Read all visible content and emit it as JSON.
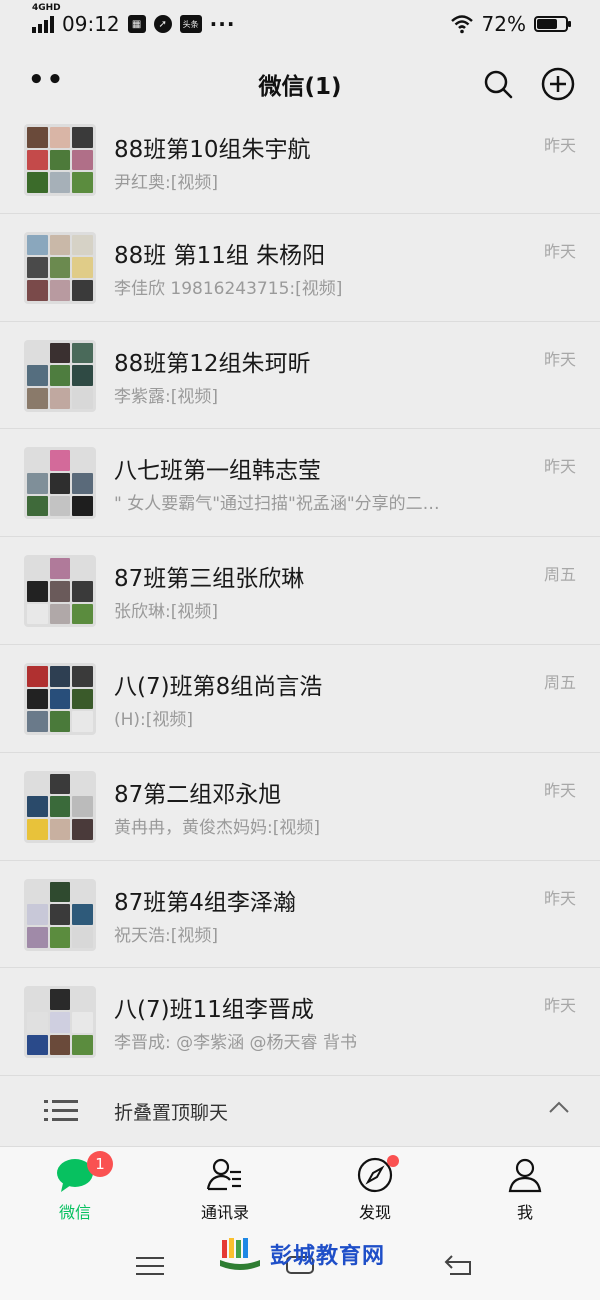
{
  "status_bar": {
    "network": "4GHD",
    "time": "09:12",
    "notif_badge": "头条",
    "more": "···",
    "battery": "72%",
    "battery_level": 0.72
  },
  "header": {
    "title": "微信(1)"
  },
  "chats": [
    {
      "name": "88班第10组朱宇航",
      "preview": "尹红奥:[视频]",
      "time": "昨天",
      "tiles": [
        "#6a4a3a",
        "#d9b5a6",
        "#3a3a3a",
        "#c44a4a",
        "#4d7a3a",
        "#b06f88",
        "#3b6b2a",
        "#a6b0b8",
        "#5b8c3e"
      ]
    },
    {
      "name": "88班  第11组  朱杨阳",
      "preview": "李佳欣 19816243715:[视频]",
      "time": "昨天",
      "tiles": [
        "#8aa7bd",
        "#c9b8a8",
        "#d6d2c6",
        "#4a4a4a",
        "#6b8a4f",
        "#e0cc88",
        "#7a4a4a",
        "#b89aa0",
        "#3a3a3a"
      ]
    },
    {
      "name": "88班第12组朱珂昕",
      "preview": "李紫露:[视频]",
      "time": "昨天",
      "tiles": [
        "#dddddd",
        "#3a3030",
        "#4a6a5a",
        "#556e7f",
        "#4e7d3f",
        "#2f4a44",
        "#8a7a6a",
        "#c0a8a0",
        "#d8d8d8"
      ]
    },
    {
      "name": "八七班第一组韩志莹",
      "preview": "\" 女人要霸气\"通过扫描\"祝孟涵\"分享的二…",
      "time": "昨天",
      "tiles": [
        "#dddddd",
        "#d36a9a",
        "#dddddd",
        "#7f8f99",
        "#2e2e2e",
        "#5a6a7a",
        "#3f6a3a",
        "#c3c3c3",
        "#1e1e1e"
      ]
    },
    {
      "name": "87班第三组张欣琳",
      "preview": "张欣琳:[视频]",
      "time": "周五",
      "tiles": [
        "#dddddd",
        "#b07a9a",
        "#dddddd",
        "#222222",
        "#6a5a5a",
        "#3a3a3a",
        "#e8e8e8",
        "#b0a8a8",
        "#5b8c3e"
      ]
    },
    {
      "name": "八(7)班第8组尚言浩",
      "preview": "(H):[视频]",
      "time": "周五",
      "tiles": [
        "#b03030",
        "#2e3f52",
        "#3a3a3a",
        "#222222",
        "#284e7a",
        "#3a5a2a",
        "#6a7a8a",
        "#4a7a3a",
        "#e8e8e8"
      ]
    },
    {
      "name": "87第二组邓永旭",
      "preview": "黄冉冉，黄俊杰妈妈:[视频]",
      "time": "昨天",
      "tiles": [
        "#dddddd",
        "#3a3a3a",
        "#dddddd",
        "#2a4a6a",
        "#3a6a3a",
        "#bbbbbb",
        "#e8c23a",
        "#c8b0a0",
        "#4a3a3a"
      ]
    },
    {
      "name": "87班第4组李泽瀚",
      "preview": "祝天浩:[视频]",
      "time": "昨天",
      "tiles": [
        "#dddddd",
        "#2f4a2f",
        "#dddddd",
        "#c8c8d8",
        "#3a3a3a",
        "#2e5a7a",
        "#a08aa8",
        "#5b8c3e",
        "#d8d8d8"
      ]
    },
    {
      "name": "八(7)班11组李晋成",
      "preview": "李晋成: @李紫涵 @杨天睿 背书",
      "time": "昨天",
      "tiles": [
        "#dddddd",
        "#2a2a2a",
        "#dddddd",
        "#e0e0e0",
        "#cfcfe0",
        "#e8e8e8",
        "#2a4a8a",
        "#6a4a3a",
        "#5b8c3e"
      ]
    }
  ],
  "collapse": {
    "label": "折叠置顶聊天"
  },
  "tabs": [
    {
      "label": "微信",
      "badge": "1",
      "icon": "chat-bubble-icon",
      "active": true
    },
    {
      "label": "通讯录",
      "icon": "contacts-icon"
    },
    {
      "label": "发现",
      "icon": "compass-icon",
      "dot": true
    },
    {
      "label": "我",
      "icon": "person-icon"
    }
  ],
  "watermark": {
    "text": "彭城教育网"
  },
  "colors": {
    "accent": "#07c160",
    "badge": "#fa5151",
    "background": "#ededed"
  }
}
